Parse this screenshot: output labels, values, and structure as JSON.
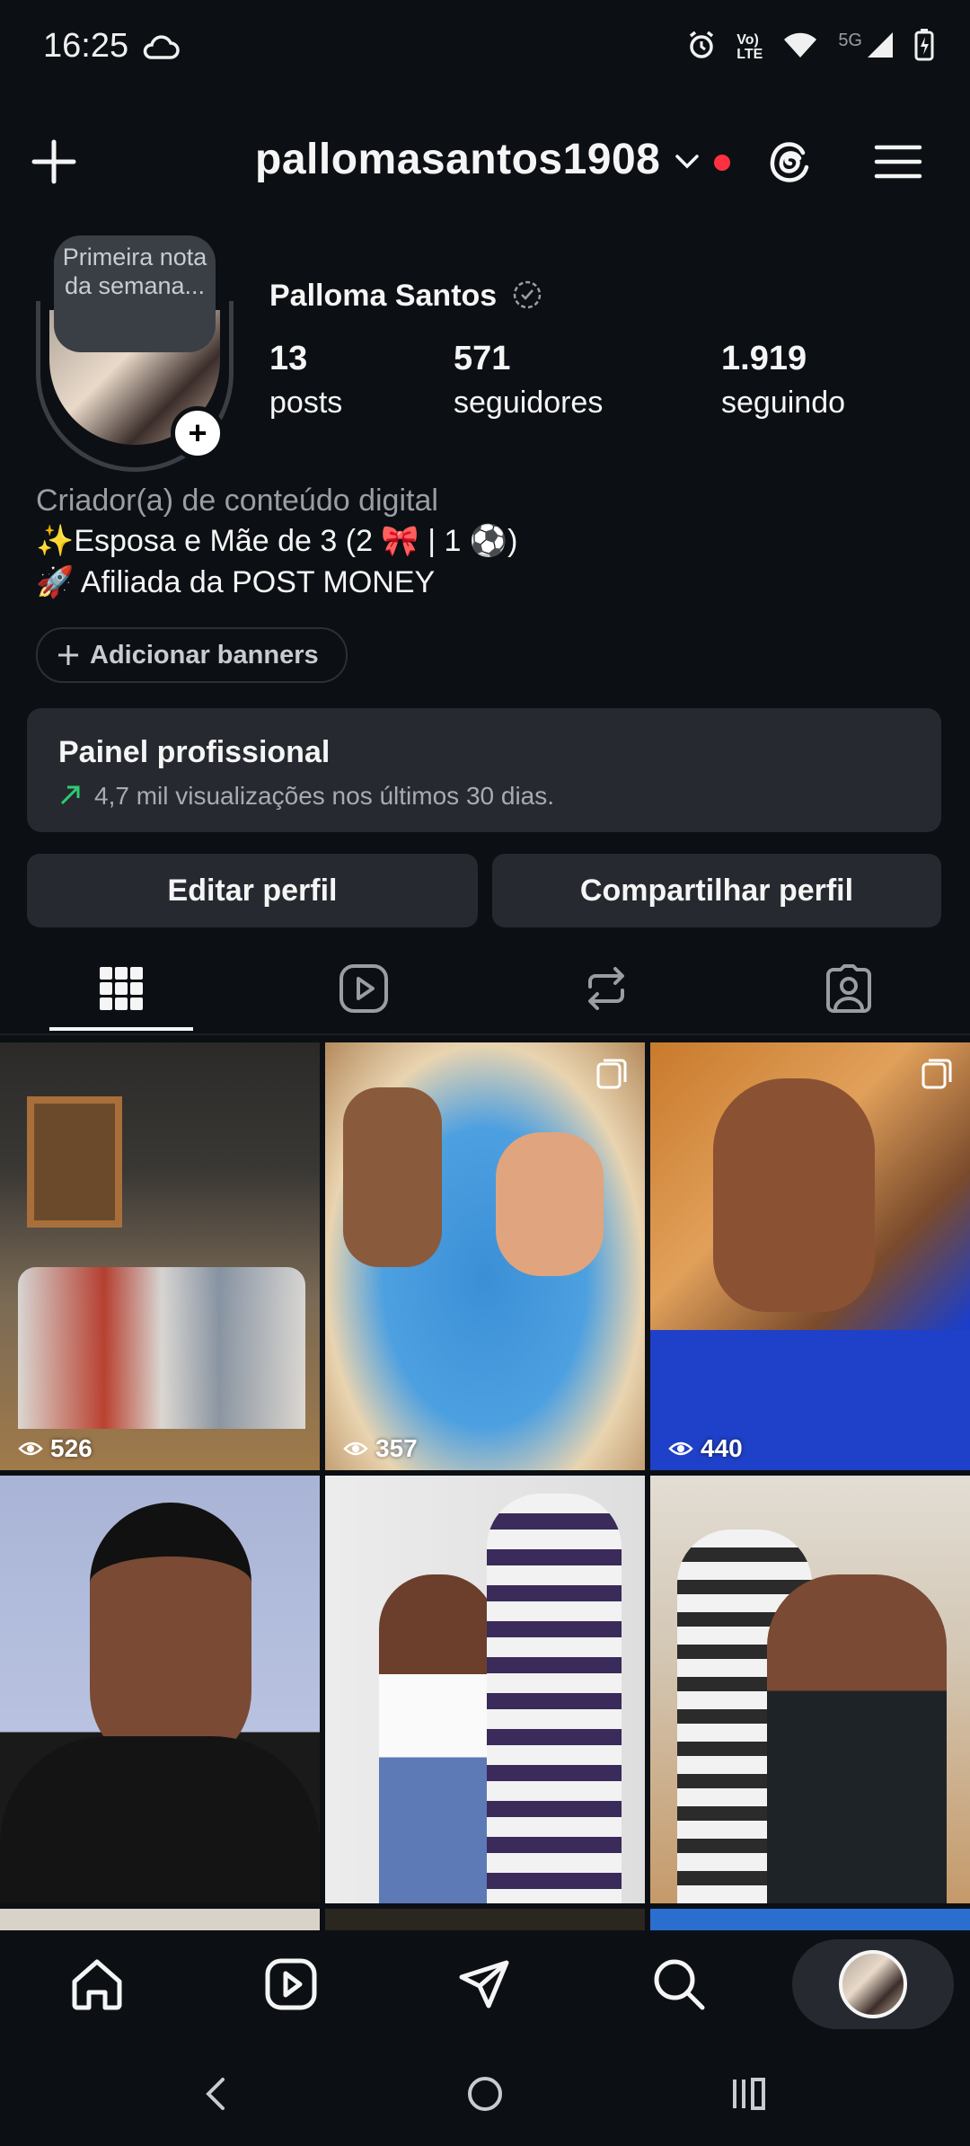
{
  "status_bar": {
    "time": "16:25",
    "network": "5G"
  },
  "header": {
    "username": "pallomasantos1908"
  },
  "profile": {
    "note": "Primeira nota da semana...",
    "name": "Palloma Santos",
    "stats": [
      {
        "value": "13",
        "label": "posts"
      },
      {
        "value": "571",
        "label": "seguidores"
      },
      {
        "value": "1.919",
        "label": "seguindo"
      }
    ],
    "category": "Criador(a) de conteúdo digital",
    "bio_line1": "✨Esposa e Mãe de 3 (2 🎀 | 1 ⚽)",
    "bio_line2": "🚀 Afiliada da POST MONEY",
    "add_banners": "Adicionar banners"
  },
  "panel": {
    "title": "Painel profissional",
    "subtitle": "4,7 mil visualizações nos últimos 30 dias.",
    "accent": "#2ecc71"
  },
  "buttons": {
    "edit": "Editar perfil",
    "share": "Compartilhar perfil"
  },
  "tabs": [
    "grid-icon",
    "reels-icon",
    "reposts-icon",
    "tagged-icon"
  ],
  "posts": [
    {
      "views": "526",
      "multi": false
    },
    {
      "views": "357",
      "multi": true
    },
    {
      "views": "440",
      "multi": true
    },
    {
      "views": "",
      "multi": false
    },
    {
      "views": "",
      "multi": false
    },
    {
      "views": "",
      "multi": false
    }
  ],
  "bottom_nav": [
    "home-icon",
    "reels-icon",
    "direct-icon",
    "search-icon",
    "profile-avatar"
  ],
  "colors": {
    "background": "#0c1014",
    "surface": "#262a30",
    "notification": "#ff3040"
  }
}
